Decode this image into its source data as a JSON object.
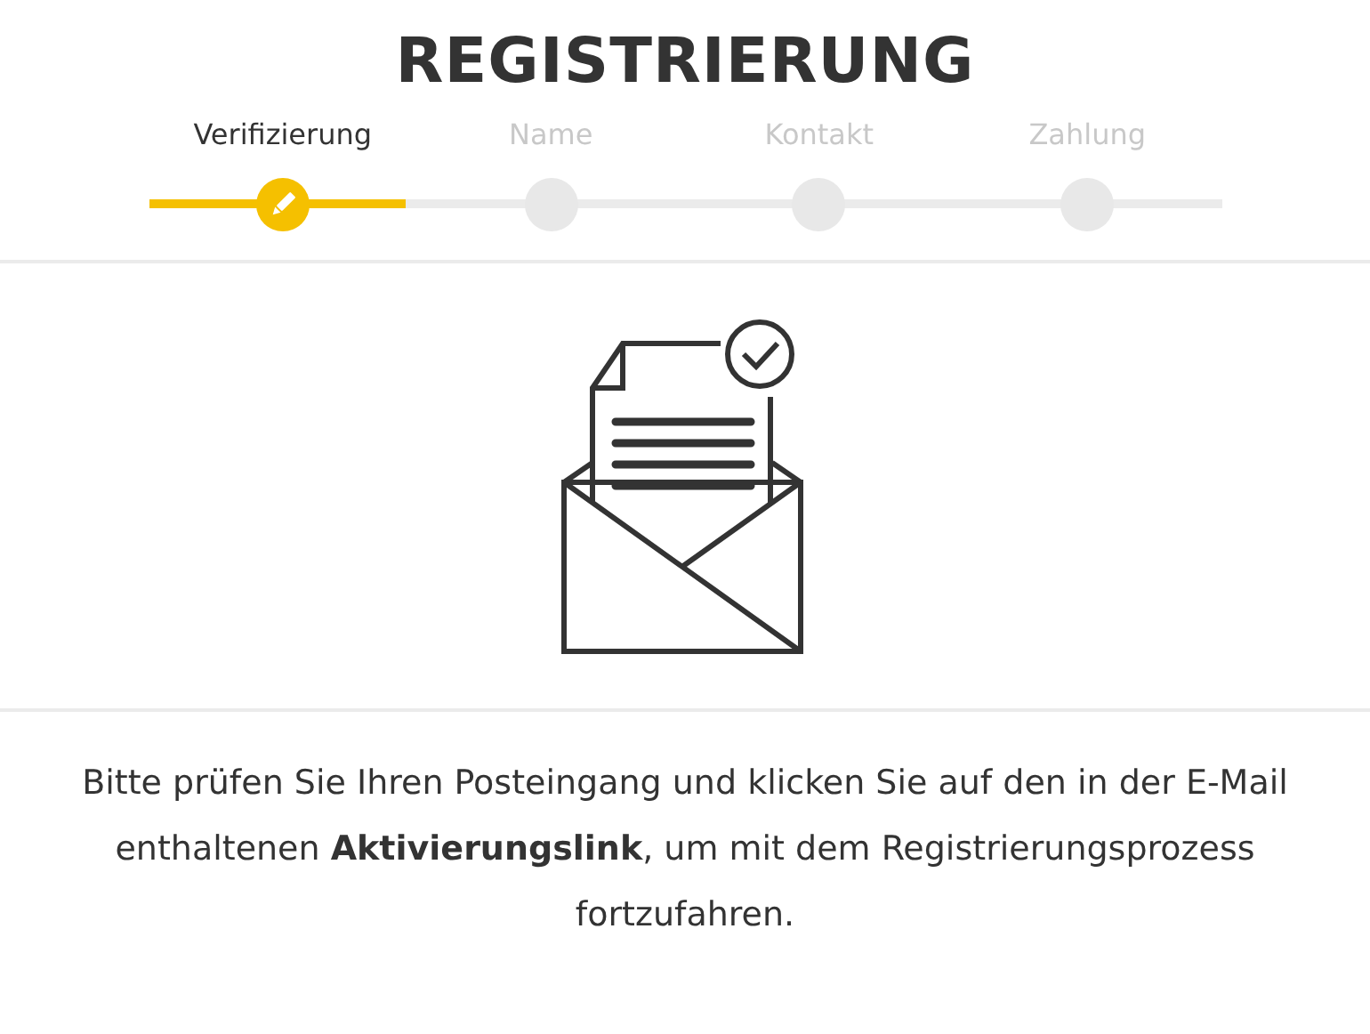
{
  "title": "REGISTRIERUNG",
  "steps": [
    {
      "label": "Verifizierung",
      "selected": true
    },
    {
      "label": "Name",
      "selected": false
    },
    {
      "label": "Kontakt",
      "selected": false
    },
    {
      "label": "Zahlung",
      "selected": false
    }
  ],
  "progress": {
    "level": 0.24
  },
  "message": "Bitte prüfen Sie Ihren Posteingang und klicken Sie auf den in der E-Mail enthaltenen **Aktivierungslink**, um mit dem Registrierungsprozess fortzufahren."
}
